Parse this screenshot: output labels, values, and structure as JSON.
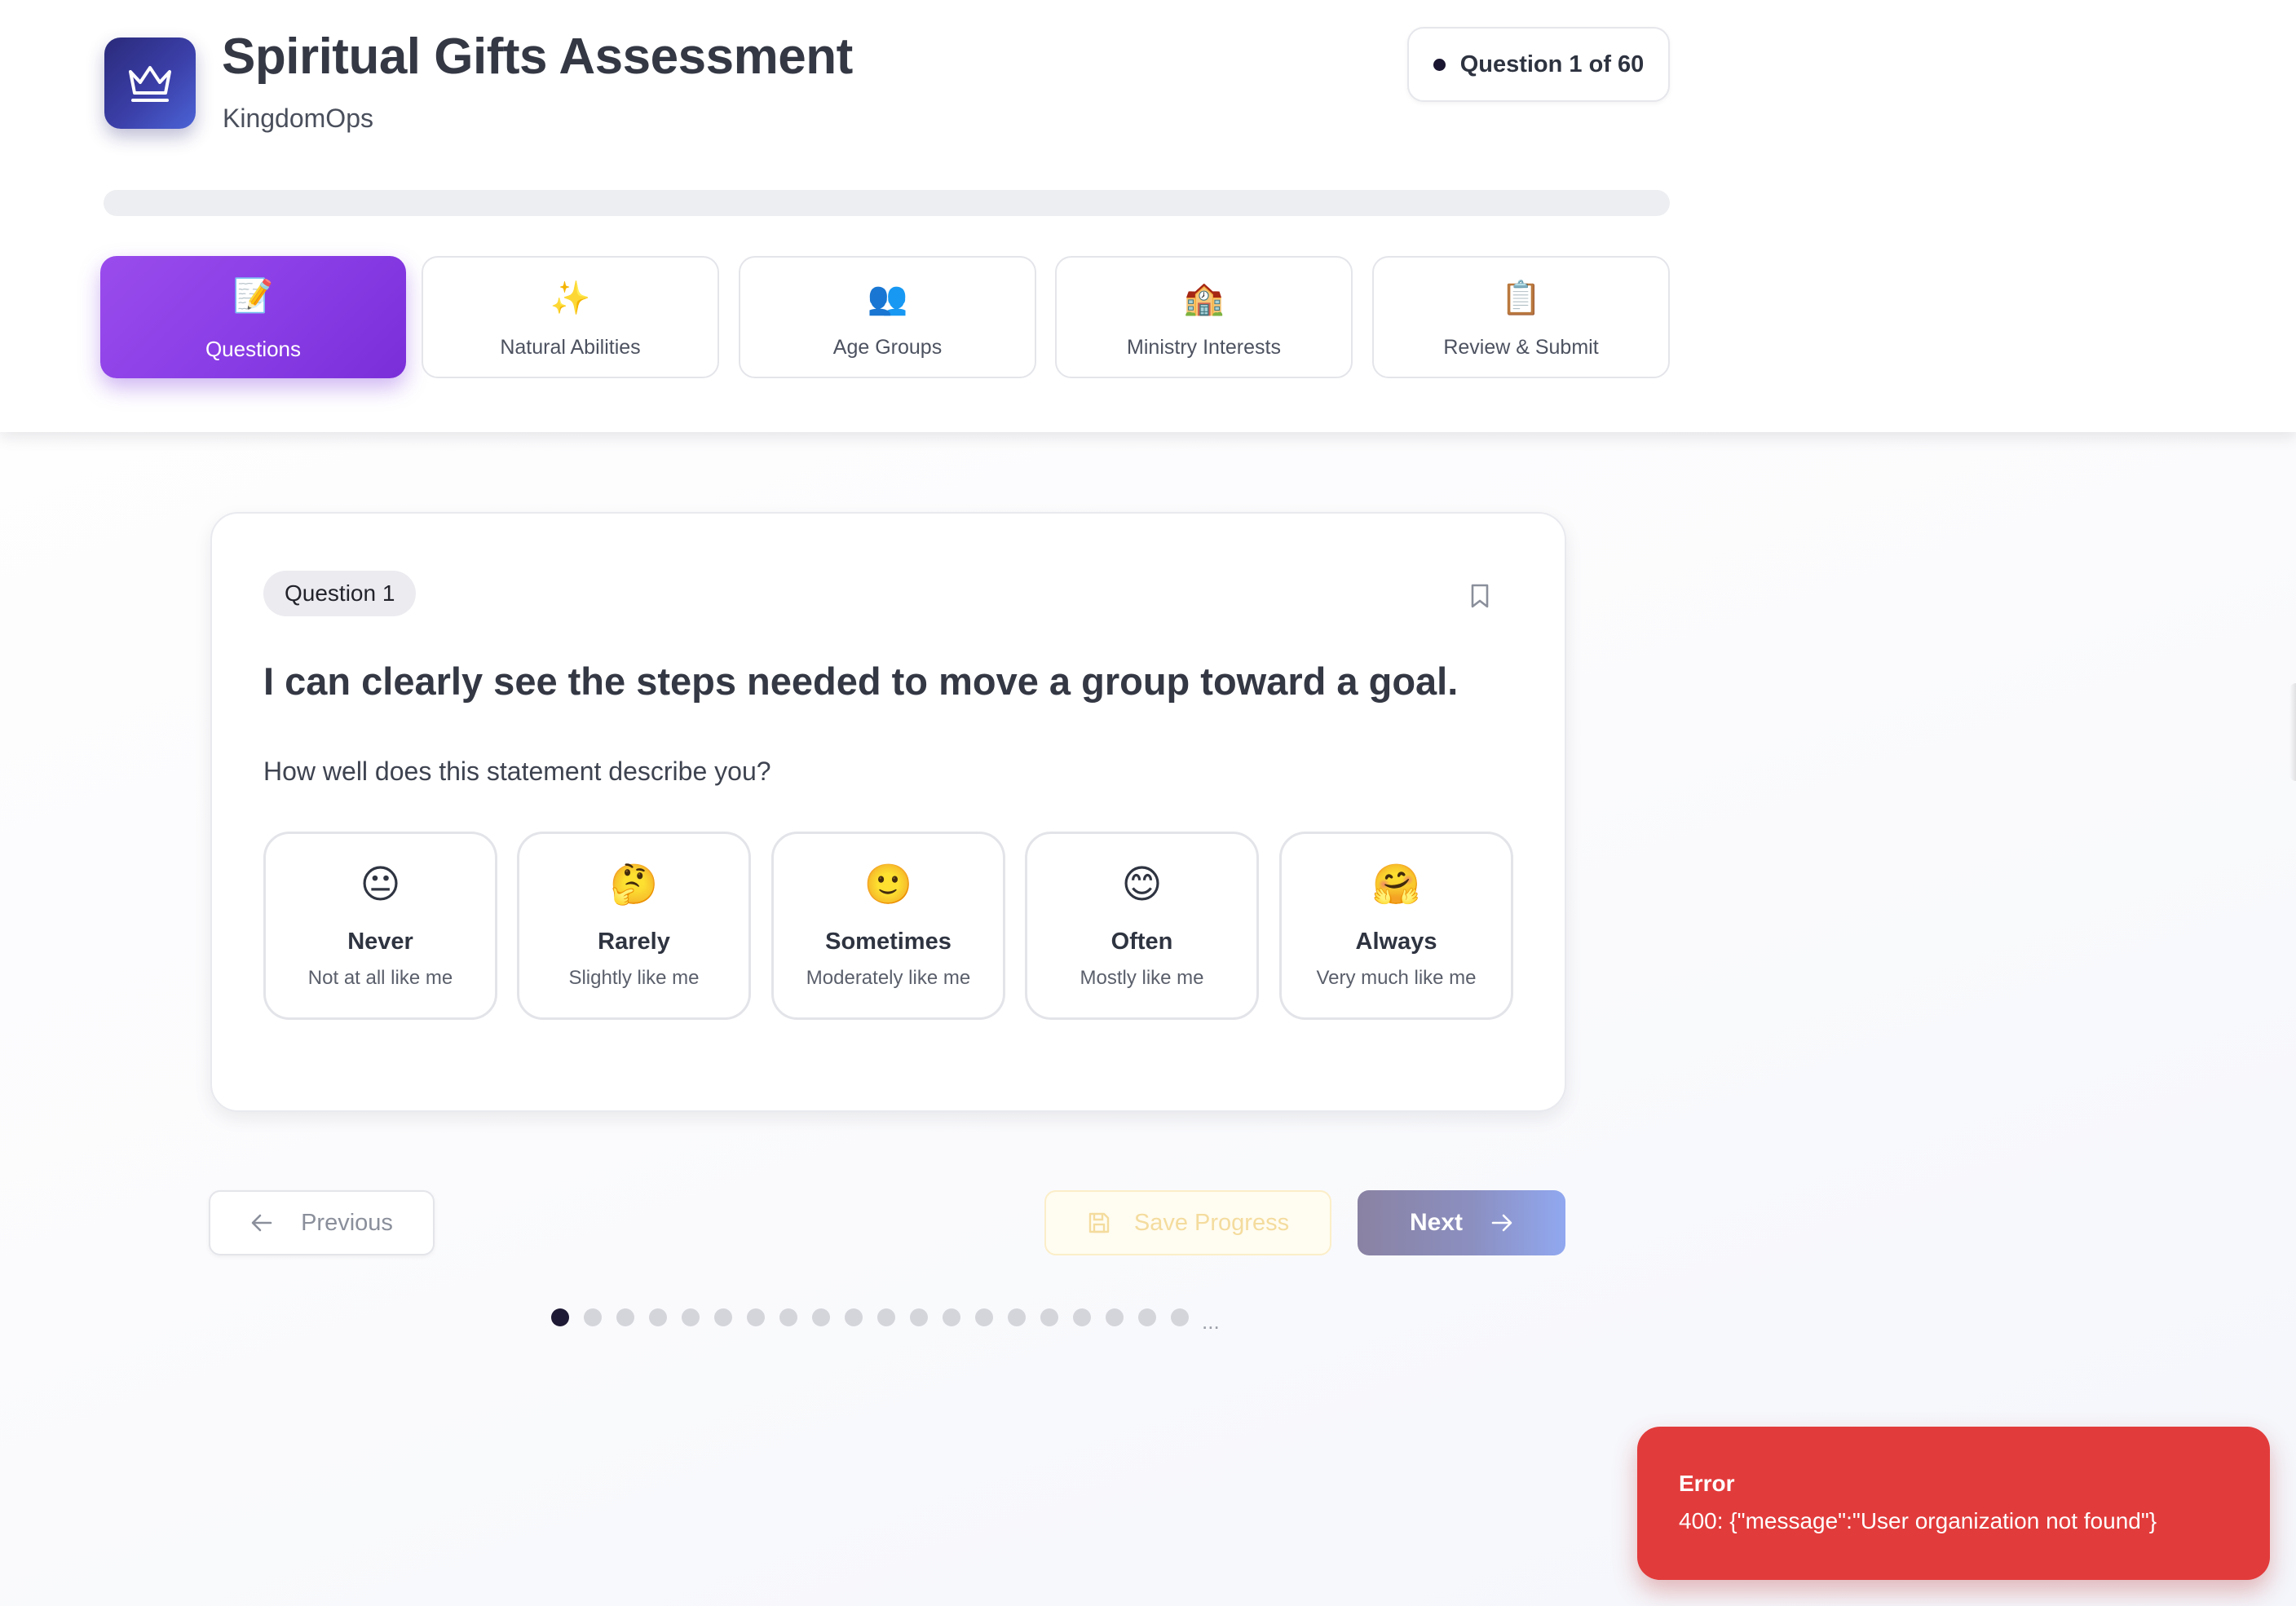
{
  "app": {
    "title": "Spiritual Gifts Assessment",
    "subtitle": "KingdomOps",
    "logo_icon": "crown-icon"
  },
  "counter": {
    "label": "Question 1 of 60"
  },
  "progress": {
    "percent": 0
  },
  "tabs": [
    {
      "label": "Questions",
      "icon": "📝",
      "icon_name": "memo-icon",
      "active": true
    },
    {
      "label": "Natural Abilities",
      "icon": "✨",
      "icon_name": "sparkles-icon",
      "active": false
    },
    {
      "label": "Age Groups",
      "icon": "👥",
      "icon_name": "people-icon",
      "active": false
    },
    {
      "label": "Ministry Interests",
      "icon": "🏫",
      "icon_name": "building-icon",
      "active": false
    },
    {
      "label": "Review & Submit",
      "icon": "📋",
      "icon_name": "clipboard-icon",
      "active": false
    }
  ],
  "question": {
    "badge": "Question 1",
    "text": "I can clearly see the steps needed to move a group toward a goal.",
    "prompt": "How well does this statement describe you?",
    "options": [
      {
        "emoji": "😐",
        "icon_name": "neutral-face-icon",
        "label": "Never",
        "description": "Not at all like me"
      },
      {
        "emoji": "🤔",
        "icon_name": "thinking-face-icon",
        "label": "Rarely",
        "description": "Slightly like me"
      },
      {
        "emoji": "🙂",
        "icon_name": "slightly-smiling-face-icon",
        "label": "Sometimes",
        "description": "Moderately like me"
      },
      {
        "emoji": "😊",
        "icon_name": "smiling-face-icon",
        "label": "Often",
        "description": "Mostly like me"
      },
      {
        "emoji": "🤗",
        "icon_name": "hugging-face-icon",
        "label": "Always",
        "description": "Very much like me"
      }
    ]
  },
  "navigation": {
    "previous_label": "Previous",
    "save_label": "Save Progress",
    "next_label": "Next"
  },
  "pagination": {
    "visible_dots": 20,
    "current_index": 0,
    "ellipsis": "..."
  },
  "toast": {
    "title": "Error",
    "message": "400: {\"message\":\"User organization not found\"}"
  },
  "colors": {
    "accent_purple": "#8a3ee6",
    "logo_navy": "#2a2a7a",
    "error_red": "#e23b3b",
    "text_dark": "#343844"
  }
}
